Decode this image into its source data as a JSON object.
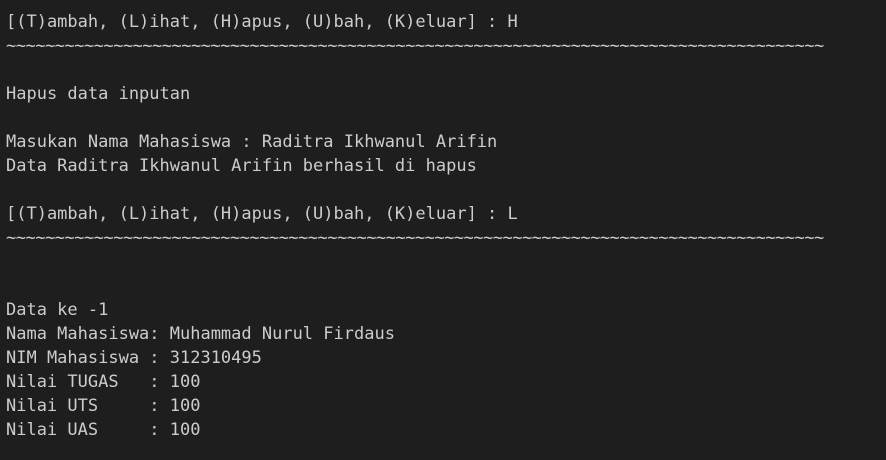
{
  "terminal": {
    "lines": [
      {
        "type": "text",
        "text": "[(T)ambah, (L)ihat, (H)apus, (U)bah, (K)eluar] : H"
      },
      {
        "type": "rule",
        "text": "~~~~~~~~~~~~~~~~~~~~~~~~~~~~~~~~~~~~~~~~~~~~~~~~~~~~~~~~~~~~~~~~~~~~~~~~~~~~~~~~~~~~"
      },
      {
        "type": "blank",
        "text": ""
      },
      {
        "type": "text",
        "text": "Hapus data inputan"
      },
      {
        "type": "blank",
        "text": ""
      },
      {
        "type": "text",
        "text": "Masukan Nama Mahasiswa : Raditra Ikhwanul Arifin"
      },
      {
        "type": "text",
        "text": "Data Raditra Ikhwanul Arifin berhasil di hapus"
      },
      {
        "type": "blank",
        "text": ""
      },
      {
        "type": "text",
        "text": "[(T)ambah, (L)ihat, (H)apus, (U)bah, (K)eluar] : L"
      },
      {
        "type": "rule",
        "text": "~~~~~~~~~~~~~~~~~~~~~~~~~~~~~~~~~~~~~~~~~~~~~~~~~~~~~~~~~~~~~~~~~~~~~~~~~~~~~~~~~~~~"
      },
      {
        "type": "blank",
        "text": ""
      },
      {
        "type": "blank",
        "text": ""
      },
      {
        "type": "text",
        "text": "Data ke -1"
      },
      {
        "type": "text",
        "text": "Nama Mahasiswa: Muhammad Nurul Firdaus"
      },
      {
        "type": "text",
        "text": "NIM Mahasiswa : 312310495"
      },
      {
        "type": "text",
        "text": "Nilai TUGAS   : 100"
      },
      {
        "type": "text",
        "text": "Nilai UTS     : 100"
      },
      {
        "type": "text",
        "text": "Nilai UAS     : 100"
      }
    ]
  },
  "colors": {
    "background": "#1e1e1e",
    "foreground": "#cccccc"
  }
}
